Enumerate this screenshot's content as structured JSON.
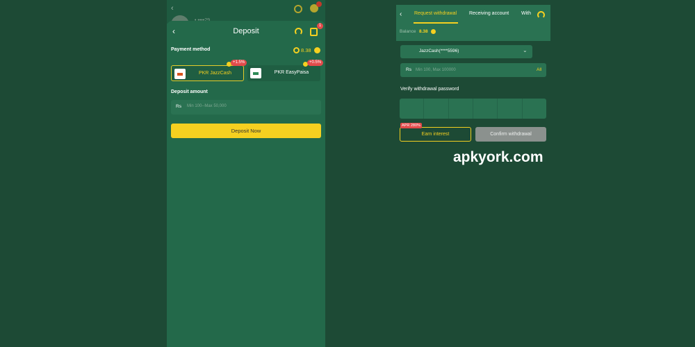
{
  "background_strip": {
    "back_glyph": "‹",
    "user_text": "• ••••29",
    "icons": [
      "support-icon",
      "gift-icon"
    ]
  },
  "deposit_screen": {
    "back_glyph": "‹",
    "title": "Deposit",
    "notification_count": "1",
    "payment_method_label": "Payment method",
    "balance": "8.38",
    "methods": [
      {
        "label": "PKR JazzCash",
        "bonus": "+1.5%",
        "selected": true
      },
      {
        "label": "PKR EasyPaisa",
        "bonus": "+0.5%",
        "selected": false
      }
    ],
    "deposit_amount_label": "Deposit amount",
    "currency_symbol": "Rs",
    "amount_placeholder": "Min 100--Max 50,000",
    "deposit_button": "Deposit Now"
  },
  "withdraw_screen": {
    "back_glyph": "‹",
    "tabs": [
      "Request withdrawal",
      "Receiving account",
      "With"
    ],
    "active_tab": 0,
    "balance_label": "Balance",
    "balance_value": "8.38",
    "account_value": "JazzCash(****5596)",
    "currency_symbol": "Rs",
    "amount_placeholder": "Min 100, Max 100000",
    "all_label": "All",
    "verify_label": "Verify withdrawal password",
    "pin_cells": 6,
    "apr_tag": "APR 280%",
    "earn_button": "Earn interest",
    "confirm_button": "Confirm withdrawal"
  },
  "watermark": "apkyork.com",
  "colors": {
    "background": "#1d4a35",
    "panel": "#23694a",
    "field": "#2a7252",
    "accent": "#f5d020",
    "badge": "#e24b4b",
    "disabled": "#8b918e"
  }
}
